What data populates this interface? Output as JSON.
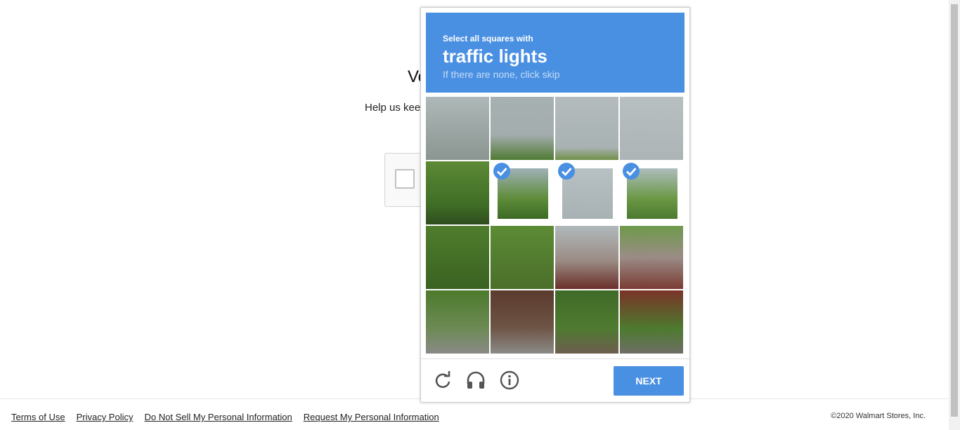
{
  "page": {
    "heading": "Verify your identity",
    "subtext": "Help us keep your account safe"
  },
  "captcha": {
    "instruction_small": "Select all squares with",
    "instruction_target": "traffic lights",
    "instruction_hint": "If there are none, click skip",
    "selected_tiles": [
      5,
      6,
      7
    ],
    "next_label": "NEXT",
    "accent_color": "#4a90e2"
  },
  "footer": {
    "links": [
      "Terms of Use",
      "Privacy Policy",
      "Do Not Sell My Personal Information",
      "Request My Personal Information"
    ],
    "copyright": "©2020 Walmart Stores, Inc."
  }
}
